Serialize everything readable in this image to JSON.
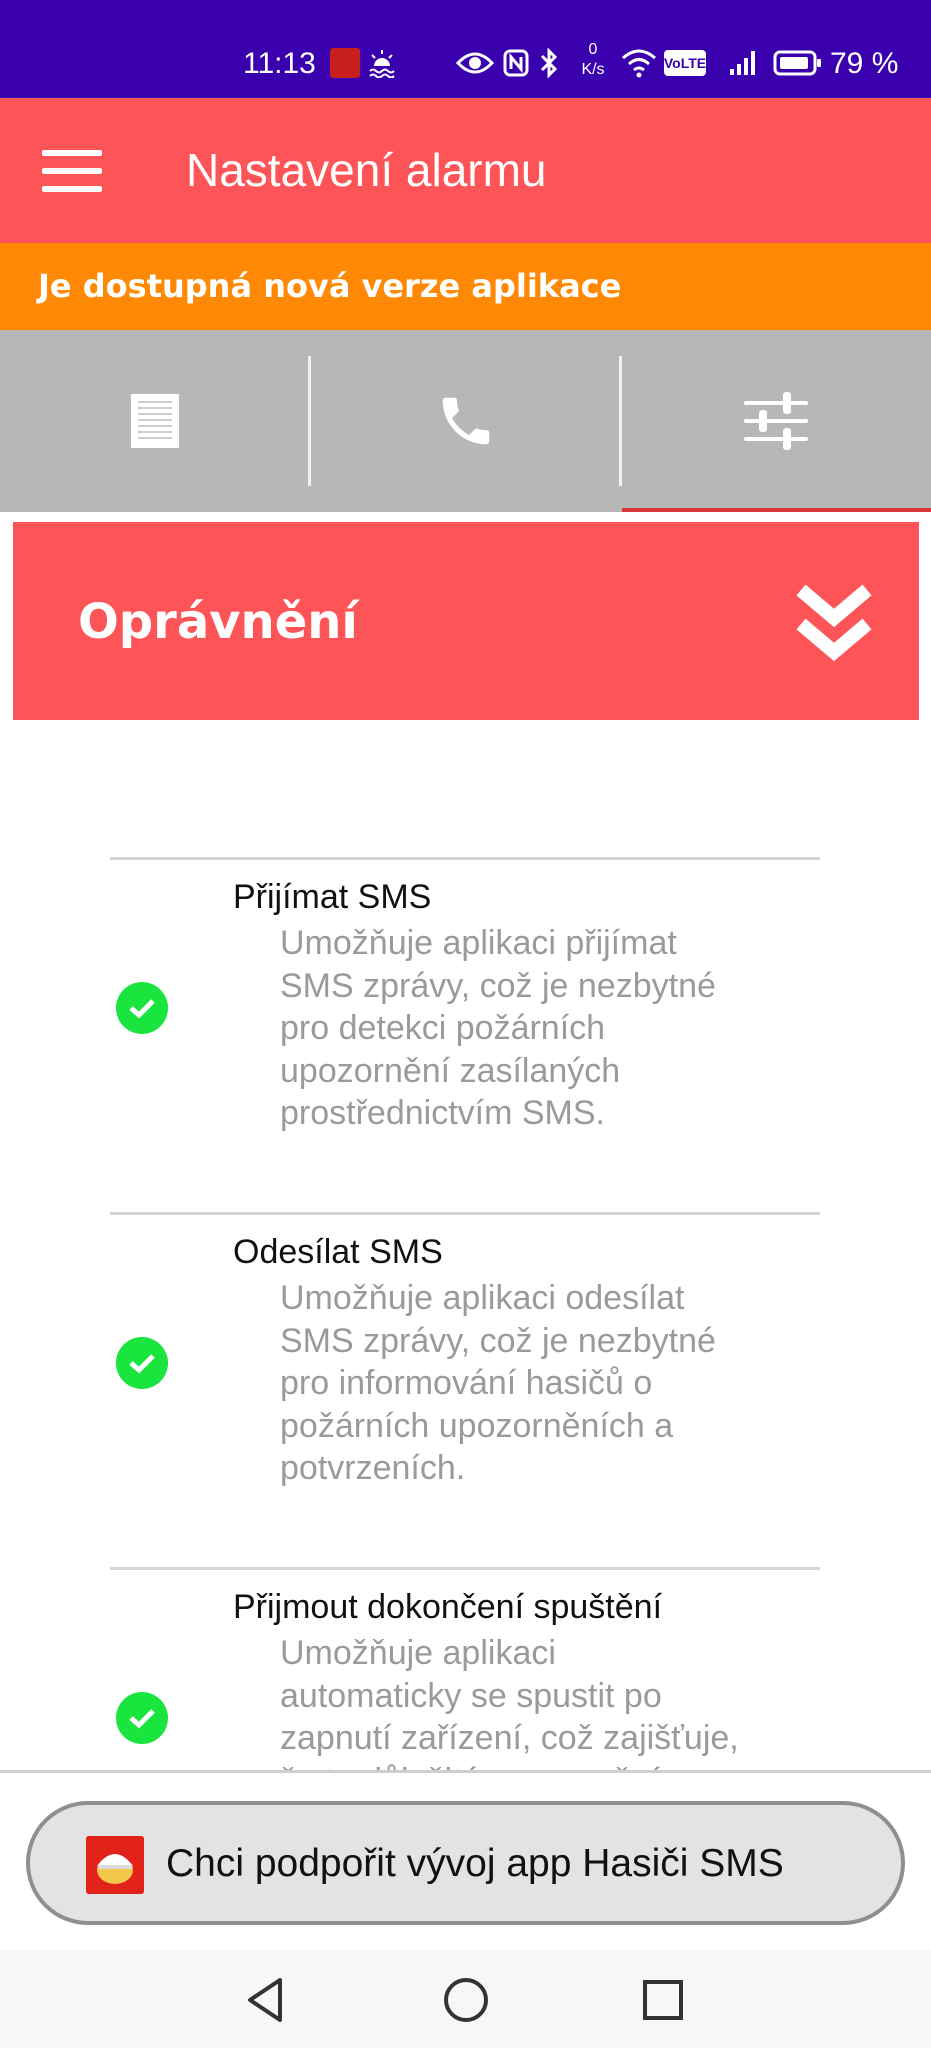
{
  "status_bar": {
    "time": "11:13",
    "network_speed_value": "0",
    "network_speed_unit": "K/s",
    "volte": "VoLTE",
    "battery": "79 %",
    "background_color": "#3a00ad"
  },
  "app_bar": {
    "title": "Nastavení alarmu",
    "color": "#fd5557"
  },
  "update_banner": {
    "text": "Je dostupná nová verze aplikace",
    "color": "#ff8905"
  },
  "tabs": [
    {
      "icon": "document-icon",
      "selected": false
    },
    {
      "icon": "phone-icon",
      "selected": false
    },
    {
      "icon": "sliders-icon",
      "selected": true
    }
  ],
  "section": {
    "title": "Oprávnění",
    "chevron_icon": "double-chevron-down-icon"
  },
  "permissions": [
    {
      "title": "Přijímat SMS",
      "description_lines": [
        "Umožňuje aplikaci přijímat",
        "SMS zprávy, což je nezbytné",
        "pro detekci požárních",
        "upozornění zasílaných",
        "prostřednictvím SMS."
      ],
      "granted": true
    },
    {
      "title": "Odesílat SMS",
      "description_lines": [
        "Umožňuje aplikaci odesílat",
        "SMS zprávy, což je nezbytné",
        "pro informování hasičů o",
        "požárních upozorněních a",
        "potvrzeních."
      ],
      "granted": true
    },
    {
      "title": "Přijmout dokončení spuštění",
      "description_lines": [
        "Umožňuje aplikaci",
        "automaticky se spustit po",
        "zapnutí zařízení, což zajišťuje,",
        "že to důležité upozornění"
      ],
      "granted": true
    }
  ],
  "support_button": {
    "label": "Chci podpořit vývoj app Hasiči SMS"
  },
  "nav_bar": {
    "buttons": [
      "back-icon",
      "home-icon",
      "recents-icon"
    ]
  }
}
